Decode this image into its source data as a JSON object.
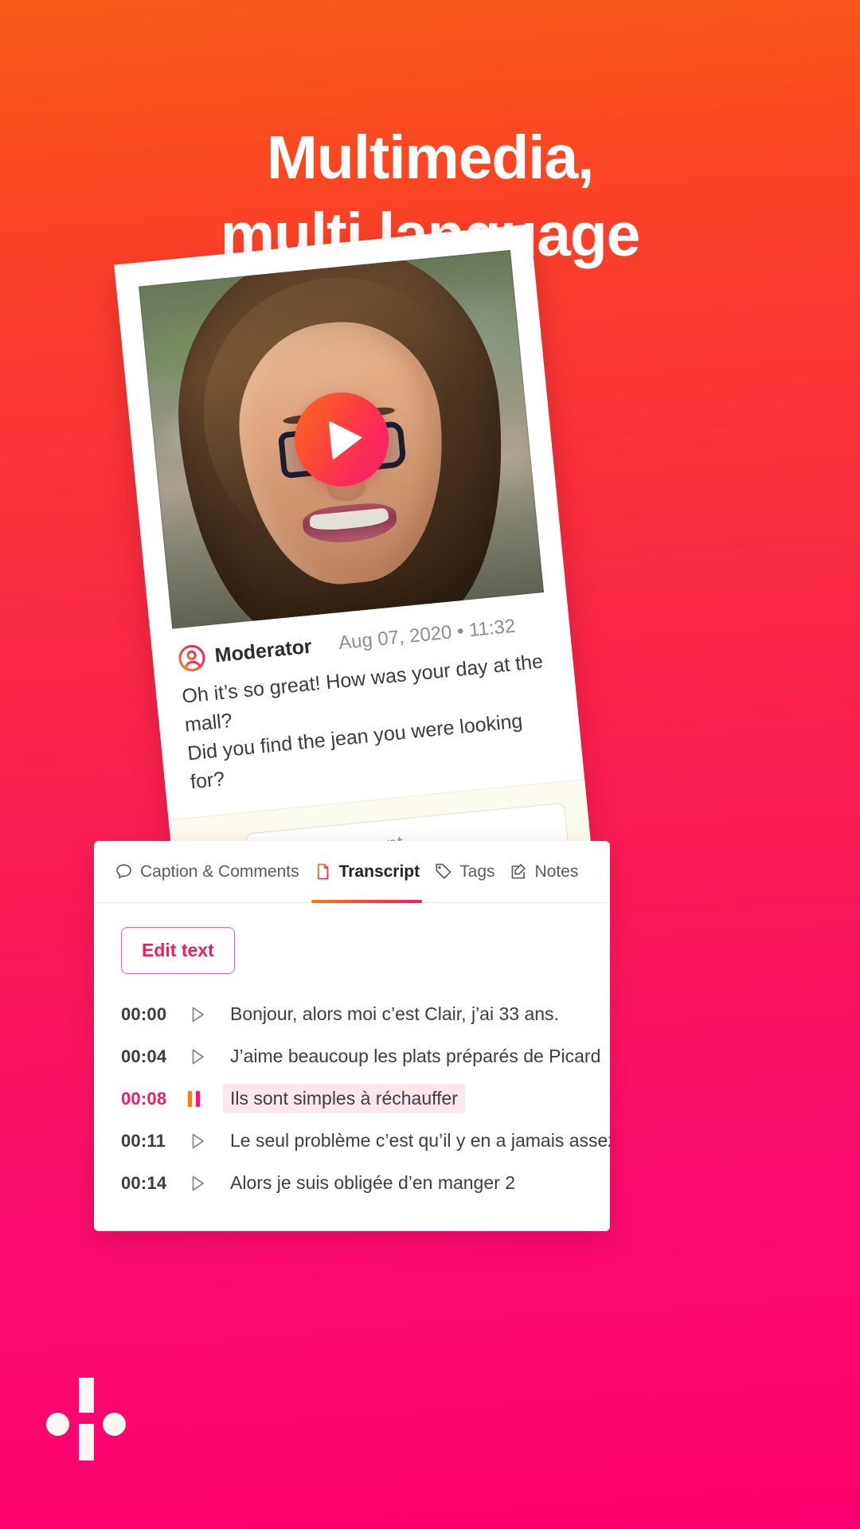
{
  "theme": {
    "bg_gradient_start": "#F95B17",
    "bg_gradient_end": "#FB006E",
    "accent_orange": "#F97B1A",
    "accent_pink": "#F9166C",
    "active_tab_text": "#232329",
    "edit_button_color": "#E81F63",
    "highlight_row_bg": "#FDE6EC"
  },
  "headline": {
    "line1": "Multimedia,",
    "line2": "multi language"
  },
  "card": {
    "play_button_label": "play-video",
    "author": "Moderator",
    "timestamp": "Aug 07, 2020 • 11:32",
    "caption_line1": "Oh it’s so great! How was your day at the mall?",
    "caption_line2": "Did you find the jean you were looking for?",
    "comment_placeholder": "Add a comment"
  },
  "panel": {
    "tabs": [
      {
        "label": "Caption & Comments",
        "icon": "comment-bubble-icon",
        "active": false
      },
      {
        "label": "Transcript",
        "icon": "document-icon",
        "active": true
      },
      {
        "label": "Tags",
        "icon": "tag-icon",
        "active": false
      },
      {
        "label": "Notes",
        "icon": "note-edit-icon",
        "active": false
      }
    ],
    "edit_button": "Edit text",
    "transcript": [
      {
        "time": "00:00",
        "text": "Bonjour, alors moi c’est Clair, j’ai 33 ans.",
        "state": "play"
      },
      {
        "time": "00:04",
        "text": "J’aime beaucoup les plats préparés de Picard",
        "state": "play"
      },
      {
        "time": "00:08",
        "text": "Ils sont simples à réchauffer",
        "state": "pause"
      },
      {
        "time": "00:11",
        "text": "Le seul problème c’est qu’il y en a jamais assez",
        "state": "play"
      },
      {
        "time": "00:14",
        "text": "Alors je suis obligée d’en manger 2",
        "state": "play"
      }
    ]
  }
}
